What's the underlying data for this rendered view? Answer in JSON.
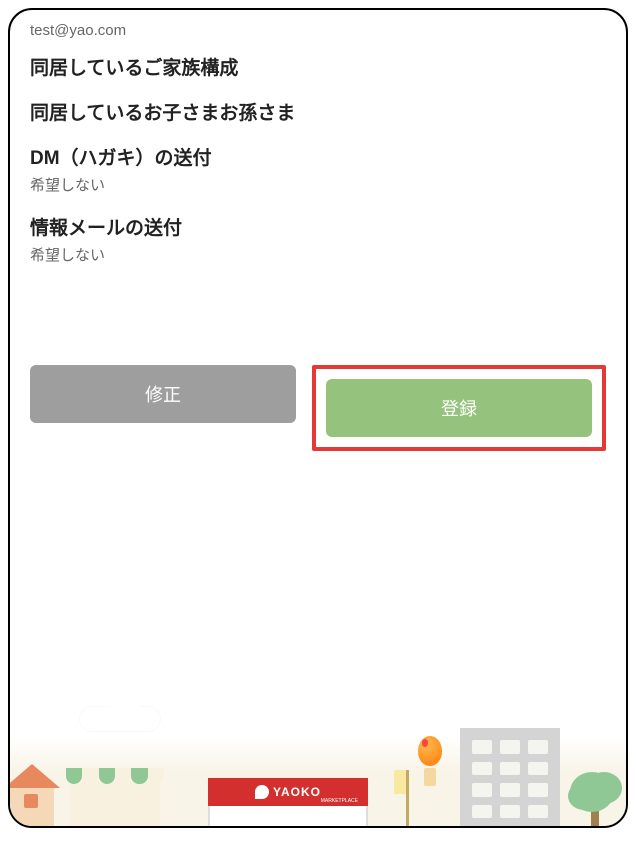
{
  "email": "test@yao.com",
  "sections": {
    "family": {
      "title": "同居しているご家族構成",
      "value": ""
    },
    "children": {
      "title": "同居しているお子さまお孫さま",
      "value": ""
    },
    "dm": {
      "title": "DM（ハガキ）の送付",
      "value": "希望しない"
    },
    "mail": {
      "title": "情報メールの送付",
      "value": "希望しない"
    }
  },
  "buttons": {
    "edit": "修正",
    "register": "登録"
  },
  "brand": {
    "name": "YAOKO",
    "tagline": "MARKETPLACE"
  }
}
